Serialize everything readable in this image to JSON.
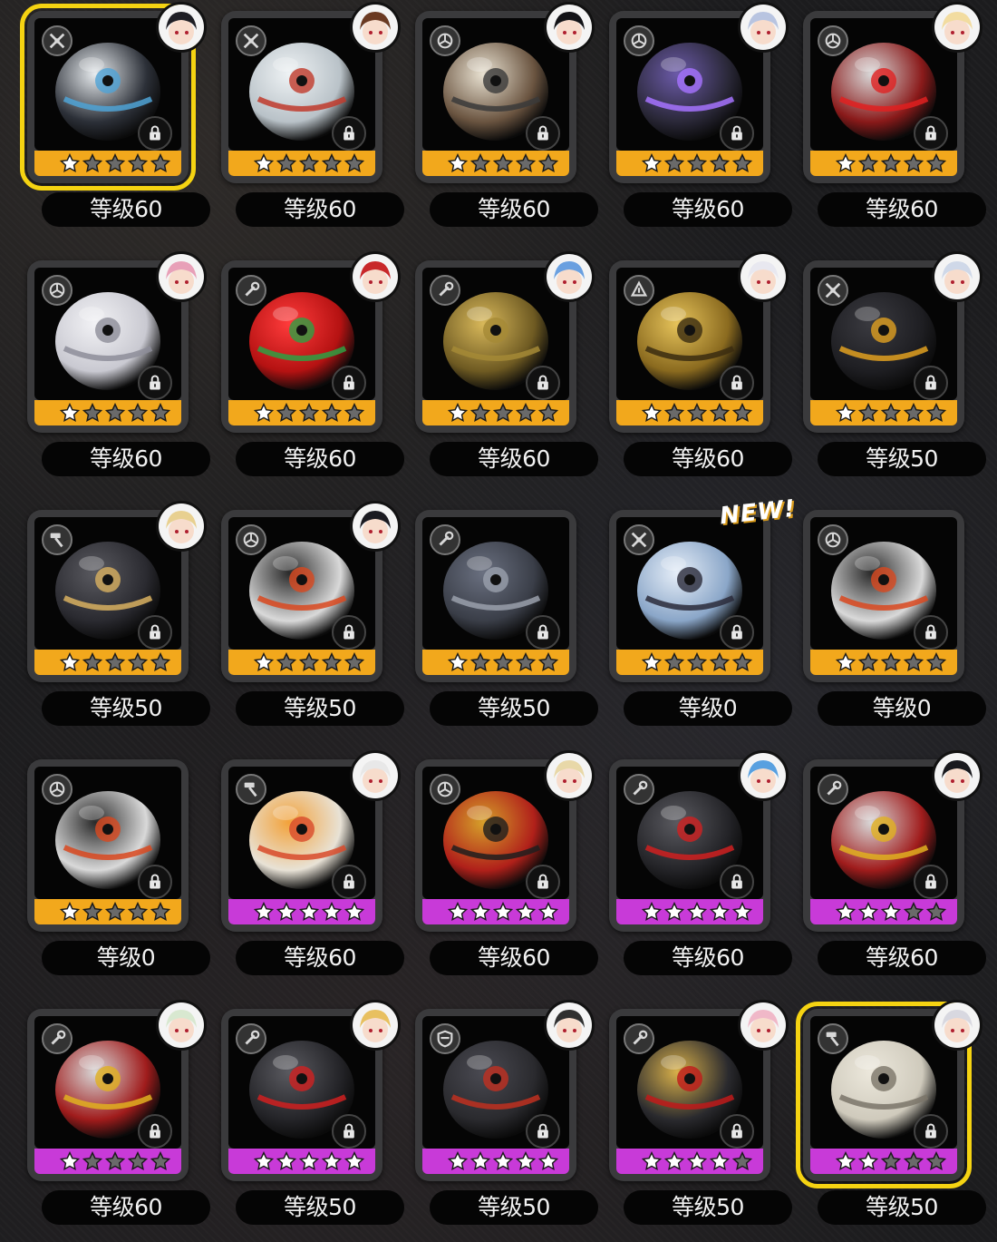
{
  "colors": {
    "selected_outline": "#f5d312",
    "rarity_orange": "#f2a81c",
    "rarity_purple": "#c83ad8",
    "star_filled": "#ffffff",
    "star_empty": "#6a6a6a",
    "card_frame": "#3a3a3c",
    "level_bg": "#050505"
  },
  "items": [
    {
      "level": "等级60",
      "rarity": "orange",
      "stars": 1,
      "type_icon": "crossed-tools-icon",
      "art": "shark-helmet-bangboo",
      "avatar": "character-avatar",
      "locked": true,
      "selected": true,
      "new": false
    },
    {
      "level": "等级60",
      "rarity": "orange",
      "stars": 1,
      "type_icon": "crossed-tools-icon",
      "art": "crystal-orb",
      "avatar": "character-avatar",
      "locked": true,
      "selected": false,
      "new": false
    },
    {
      "level": "等级60",
      "rarity": "orange",
      "stars": 1,
      "type_icon": "triskelion-icon",
      "art": "shrine-house",
      "avatar": "character-avatar",
      "locked": true,
      "selected": false,
      "new": false
    },
    {
      "level": "等级60",
      "rarity": "orange",
      "stars": 1,
      "type_icon": "triskelion-icon",
      "art": "dark-purple-sphere",
      "avatar": "character-avatar",
      "locked": true,
      "selected": false,
      "new": false
    },
    {
      "level": "等级60",
      "rarity": "orange",
      "stars": 1,
      "type_icon": "triskelion-icon",
      "art": "red-hex-sphere",
      "avatar": "character-avatar",
      "locked": true,
      "selected": false,
      "new": false
    },
    {
      "level": "等级60",
      "rarity": "orange",
      "stars": 1,
      "type_icon": "triskelion-icon",
      "art": "white-feather-orb",
      "avatar": "character-avatar",
      "locked": true,
      "selected": false,
      "new": false
    },
    {
      "level": "等级60",
      "rarity": "orange",
      "stars": 1,
      "type_icon": "wrench-icon",
      "art": "red-apple",
      "avatar": "character-avatar",
      "locked": true,
      "selected": false,
      "new": false
    },
    {
      "level": "等级60",
      "rarity": "orange",
      "stars": 1,
      "type_icon": "wrench-icon",
      "art": "golden-orb",
      "avatar": "character-avatar",
      "locked": true,
      "selected": false,
      "new": false
    },
    {
      "level": "等级60",
      "rarity": "orange",
      "stars": 1,
      "type_icon": "claw-icon",
      "art": "golden-birdcage",
      "avatar": "character-avatar",
      "locked": true,
      "selected": false,
      "new": false
    },
    {
      "level": "等级50",
      "rarity": "orange",
      "stars": 1,
      "type_icon": "crossed-tools-icon",
      "art": "black-zipper-sphere",
      "avatar": "character-avatar",
      "locked": true,
      "selected": false,
      "new": false
    },
    {
      "level": "等级50",
      "rarity": "orange",
      "stars": 1,
      "type_icon": "hammer-icon",
      "art": "strapped-dark-sphere",
      "avatar": "character-avatar",
      "locked": true,
      "selected": false,
      "new": false
    },
    {
      "level": "等级50",
      "rarity": "orange",
      "stars": 1,
      "type_icon": "triskelion-icon",
      "art": "white-red-bangboo",
      "avatar": "character-avatar",
      "locked": true,
      "selected": false,
      "new": false
    },
    {
      "level": "等级50",
      "rarity": "orange",
      "stars": 1,
      "type_icon": "wrench-icon",
      "art": "spiked-grey-sphere",
      "avatar": null,
      "locked": true,
      "selected": false,
      "new": false
    },
    {
      "level": "等级0",
      "rarity": "orange",
      "stars": 1,
      "type_icon": "crossed-tools-icon",
      "art": "crystal-shard-sphere",
      "avatar": null,
      "locked": true,
      "selected": false,
      "new": true,
      "new_label": "NEW!"
    },
    {
      "level": "等级0",
      "rarity": "orange",
      "stars": 1,
      "type_icon": "triskelion-icon",
      "art": "white-red-bangboo",
      "avatar": null,
      "locked": true,
      "selected": false,
      "new": false
    },
    {
      "level": "等级0",
      "rarity": "orange",
      "stars": 1,
      "type_icon": "triskelion-icon",
      "art": "white-red-bangboo",
      "avatar": null,
      "locked": true,
      "selected": false,
      "new": false
    },
    {
      "level": "等级60",
      "rarity": "purple",
      "stars": 5,
      "type_icon": "hammer-icon",
      "art": "food-bowl",
      "avatar": "character-avatar",
      "locked": true,
      "selected": false,
      "new": false
    },
    {
      "level": "等级60",
      "rarity": "purple",
      "stars": 5,
      "type_icon": "triskelion-icon",
      "art": "red-crowned-bangboo",
      "avatar": "character-avatar",
      "locked": true,
      "selected": false,
      "new": false
    },
    {
      "level": "等级60",
      "rarity": "purple",
      "stars": 5,
      "type_icon": "wrench-icon",
      "art": "black-spiked-bangboo",
      "avatar": "character-avatar",
      "locked": true,
      "selected": false,
      "new": false
    },
    {
      "level": "等级60",
      "rarity": "purple",
      "stars": 3,
      "type_icon": "wrench-icon",
      "art": "red-armored-bangboo",
      "avatar": "character-avatar",
      "locked": true,
      "selected": false,
      "new": false
    },
    {
      "level": "等级60",
      "rarity": "purple",
      "stars": 1,
      "type_icon": "wrench-icon",
      "art": "red-armored-bangboo",
      "avatar": "character-avatar",
      "locked": true,
      "selected": false,
      "new": false
    },
    {
      "level": "等级50",
      "rarity": "purple",
      "stars": 5,
      "type_icon": "wrench-icon",
      "art": "black-spiked-bangboo",
      "avatar": "character-avatar",
      "locked": true,
      "selected": false,
      "new": false
    },
    {
      "level": "等级50",
      "rarity": "purple",
      "stars": 5,
      "type_icon": "shield-icon",
      "art": "dark-armored-sphere",
      "avatar": "character-avatar",
      "locked": true,
      "selected": false,
      "new": false
    },
    {
      "level": "等级50",
      "rarity": "purple",
      "stars": 4,
      "type_icon": "wrench-icon",
      "art": "gold-cross-sphere",
      "avatar": "character-avatar",
      "locked": true,
      "selected": false,
      "new": false
    },
    {
      "level": "等级50",
      "rarity": "purple",
      "stars": 2,
      "type_icon": "hammer-icon",
      "art": "white-helmet-sphere",
      "avatar": "character-avatar",
      "locked": true,
      "selected": true,
      "new": false
    }
  ]
}
